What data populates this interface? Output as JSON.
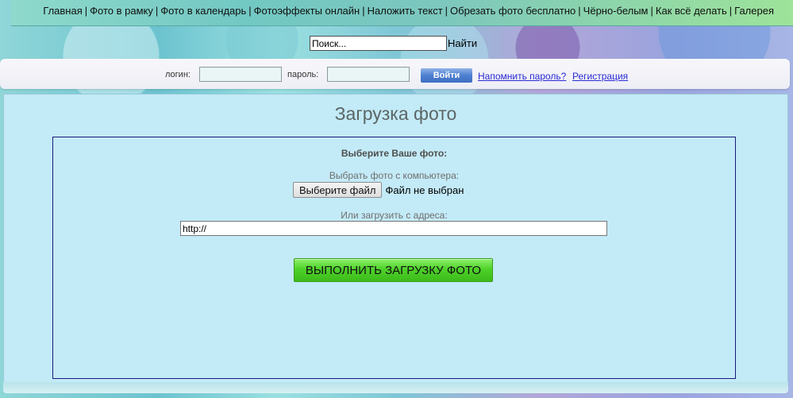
{
  "nav": {
    "items": [
      "Главная",
      "Фото в рамку",
      "Фото в календарь",
      "Фотоэффекты онлайн",
      "Наложить текст",
      "Обрезать фото бесплатно",
      "Чёрно-белым",
      "Как всё делать",
      "Галерея"
    ],
    "separator": "|"
  },
  "search": {
    "value": "Поиск...",
    "button_label": "Найти"
  },
  "login": {
    "login_label": "логин:",
    "login_value": "",
    "password_label": "пароль:",
    "password_value": "",
    "enter_button": "Войти",
    "remind_link": "Напомнить пароль?",
    "register_link": "Регистрация"
  },
  "upload": {
    "title": "Загрузка фото",
    "heading": "Выберите Ваше фото:",
    "from_computer_label": "Выбрать фото с компьютера:",
    "file_button": "Выберите файл",
    "file_status": "Файл не выбран",
    "from_url_label": "Или загрузить с адреса:",
    "url_value": "http://",
    "submit_button": "ВЫПОЛНИТЬ ЗАГРУЗКУ ФОТО"
  },
  "colors": {
    "panel_background": "#c3eaf7",
    "submit_green": "#4fd22a",
    "enter_blue": "#4d7fd0",
    "link_blue": "#2b2bd6"
  }
}
